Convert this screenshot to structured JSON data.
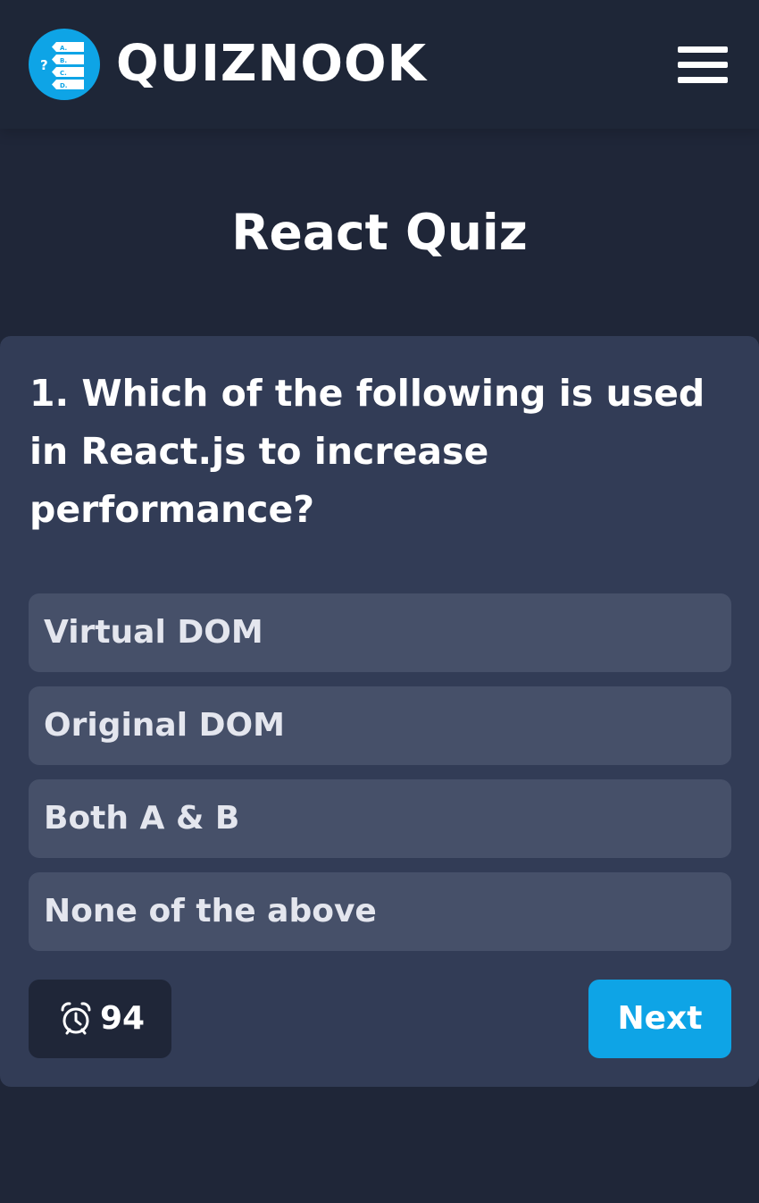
{
  "header": {
    "brand": "QUIZNOOK",
    "logo_icon": "quiz-list-icon",
    "logo_marks": [
      "?",
      "A.",
      "B.",
      "C.",
      "D."
    ],
    "menu_icon": "hamburger-menu-icon"
  },
  "quiz": {
    "title": "React Quiz",
    "question": "1. Which of the following is used in React.js to increase performance?",
    "options": [
      "Virtual DOM",
      "Original DOM",
      "Both A & B",
      "None of the above"
    ],
    "timer": {
      "icon": "alarm-clock-icon",
      "value": "94"
    },
    "next_label": "Next"
  },
  "colors": {
    "background": "#1f2638",
    "header": "#1e2637",
    "card": "#323c56",
    "option": "#465069",
    "accent": "#0ea4e6",
    "text": "#ffffff"
  }
}
